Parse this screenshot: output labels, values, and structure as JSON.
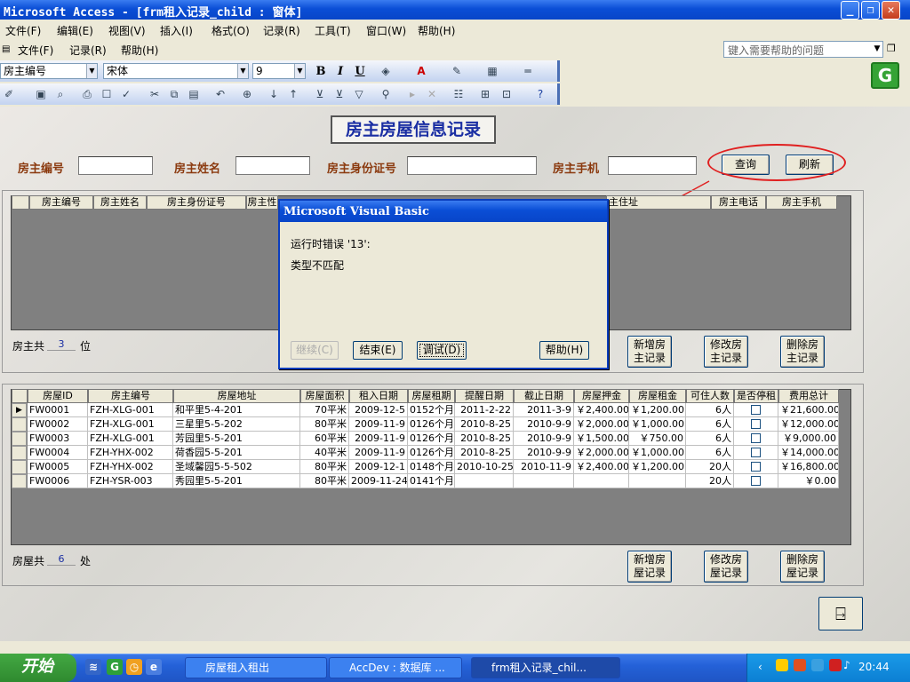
{
  "window": {
    "title": "Microsoft Access - [frm租入记录_child : 窗体]"
  },
  "menu1": [
    "文件(F)",
    "编辑(E)",
    "视图(V)",
    "插入(I)",
    "格式(O)",
    "记录(R)",
    "工具(T)",
    "窗口(W)",
    "帮助(H)"
  ],
  "menu2": [
    "文件(F)",
    "记录(R)",
    "帮助(H)"
  ],
  "help_box": {
    "placeholder": "键入需要帮助的问题"
  },
  "format_bar": {
    "field_combo": "房主编号",
    "font_combo": "宋体",
    "size_combo": "9",
    "bold": "B",
    "italic": "I",
    "underline": "U"
  },
  "form": {
    "title": "房主房屋信息记录",
    "search": {
      "owner_id_label": "房主编号",
      "owner_name_label": "房主姓名",
      "owner_idcard_label": "房主身份证号",
      "owner_mobile_label": "房主手机",
      "query_button": "查询",
      "refresh_button": "刷新"
    },
    "owner_grid_headers": [
      "房主编号",
      "房主姓名",
      "房主身份证号",
      "房主性",
      "主住址",
      "房主电话",
      "房主手机"
    ],
    "owner_count": {
      "prefix": "房主共",
      "value": "3",
      "suffix": "位"
    },
    "owner_buttons": {
      "add": [
        "新增房",
        "主记录"
      ],
      "edit": [
        "修改房",
        "主记录"
      ],
      "delete": [
        "删除房",
        "主记录"
      ]
    },
    "house_grid": {
      "headers": [
        "房屋ID",
        "房主编号",
        "房屋地址",
        "房屋面积",
        "租入日期",
        "房屋租期",
        "提醒日期",
        "截止日期",
        "房屋押金",
        "房屋租金",
        "可住人数",
        "是否停租",
        "费用总计"
      ],
      "rows": [
        [
          "FW0001",
          "FZH-XLG-001",
          "和平里5-4-201",
          "70平米",
          "2009-12-5",
          "0152个月",
          "2011-2-22",
          "2011-3-9",
          "￥2,400.00",
          "￥1,200.00",
          "6人",
          "",
          "￥21,600.00"
        ],
        [
          "FW0002",
          "FZH-XLG-001",
          "三星里5-5-202",
          "80平米",
          "2009-11-9",
          "0126个月",
          "2010-8-25",
          "2010-9-9",
          "￥2,000.00",
          "￥1,000.00",
          "6人",
          "",
          "￥12,000.00"
        ],
        [
          "FW0003",
          "FZH-XLG-001",
          "芳园里5-5-201",
          "60平米",
          "2009-11-9",
          "0126个月",
          "2010-8-25",
          "2010-9-9",
          "￥1,500.00",
          "￥750.00",
          "6人",
          "",
          "￥9,000.00"
        ],
        [
          "FW0004",
          "FZH-YHX-002",
          "荷香园5-5-201",
          "40平米",
          "2009-11-9",
          "0126个月",
          "2010-8-25",
          "2010-9-9",
          "￥2,000.00",
          "￥1,000.00",
          "6人",
          "",
          "￥14,000.00"
        ],
        [
          "FW0005",
          "FZH-YHX-002",
          "圣域馨园5-5-502",
          "80平米",
          "2009-12-1",
          "0148个月",
          "2010-10-25",
          "2010-11-9",
          "￥2,400.00",
          "￥1,200.00",
          "20人",
          "",
          "￥16,800.00"
        ],
        [
          "FW0006",
          "FZH-YSR-003",
          "秀园里5-5-201",
          "80平米",
          "2009-11-24",
          "0141个月",
          "",
          "",
          "",
          "",
          "20人",
          "",
          "￥0.00"
        ]
      ]
    },
    "house_count": {
      "prefix": "房屋共",
      "value": "6",
      "suffix": "处"
    },
    "house_buttons": {
      "add": [
        "新增房",
        "屋记录"
      ],
      "edit": [
        "修改房",
        "屋记录"
      ],
      "delete": [
        "删除房",
        "屋记录"
      ]
    }
  },
  "dialog": {
    "title": "Microsoft Visual Basic",
    "message1": "运行时错误 '13':",
    "message2": "类型不匹配",
    "continue_button": "继续(C)",
    "end_button": "结束(E)",
    "debug_button": "调试(D)",
    "help_button": "帮助(H)"
  },
  "taskbar": {
    "start": "开始",
    "tasks": [
      "房屋租入租出",
      "AccDev : 数据库 ...",
      "frm租入记录_chil..."
    ],
    "clock": "20:44"
  }
}
